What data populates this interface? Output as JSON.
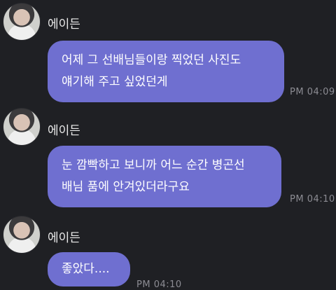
{
  "messages": [
    {
      "sender": "에이든",
      "lines": [
        "어제 그 선배님들이랑 찍었던 사진도",
        "얘기해 주고 싶었던게"
      ],
      "time": "PM 04:09"
    },
    {
      "sender": "에이든",
      "lines": [
        "눈 깜빡하고 보니까 어느 순간 병곤선",
        "배님 품에 안겨있더라구요"
      ],
      "time": "PM 04:10"
    },
    {
      "sender": "에이든",
      "lines": [
        "좋았다...."
      ],
      "time": "PM 04:10"
    }
  ],
  "colors": {
    "background": "#1f2024",
    "bubble": "#6f6fd0",
    "time": "#8c8c93"
  }
}
